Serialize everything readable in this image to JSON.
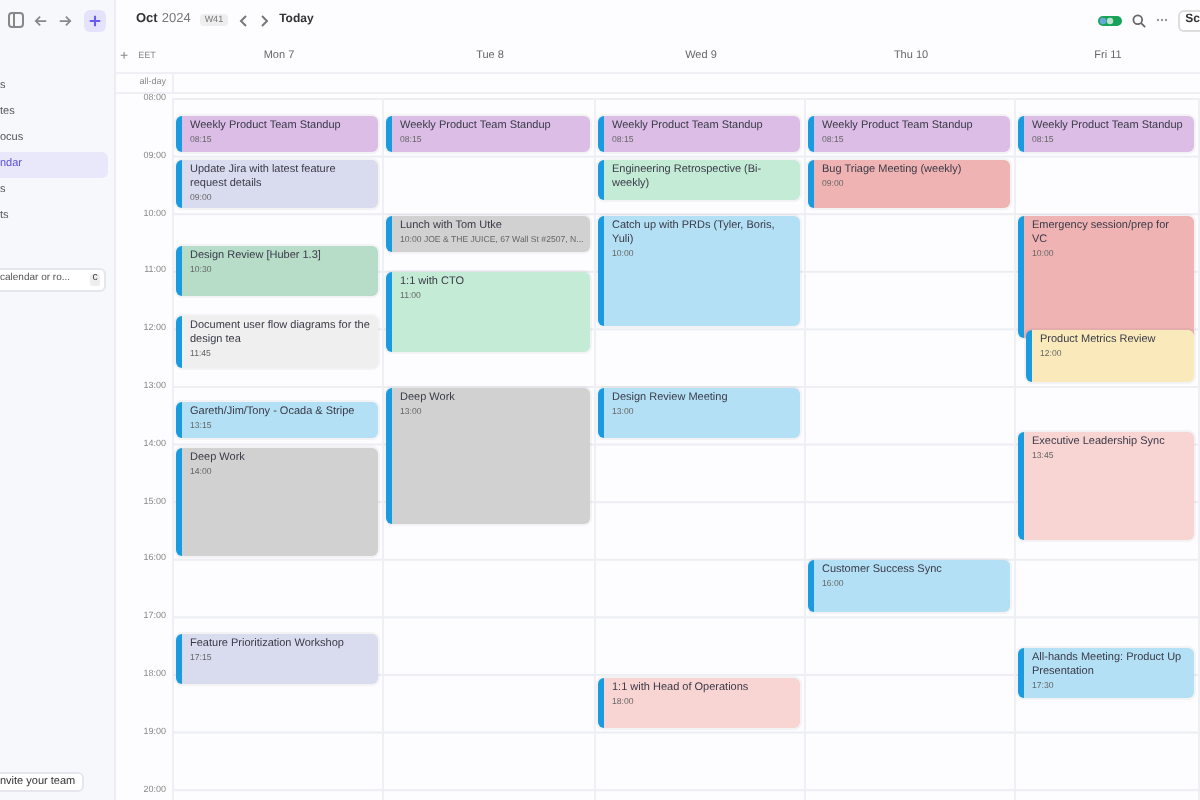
{
  "sidebar": {
    "items": [
      {
        "label": "s",
        "selected": false
      },
      {
        "label": "tes",
        "selected": false
      },
      {
        "label": "ocus",
        "selected": false
      },
      {
        "label": "ndar",
        "selected": true
      },
      {
        "label": "s",
        "selected": false
      },
      {
        "label": "ts",
        "selected": false
      }
    ],
    "search": {
      "placeholder": "calendar or ro...",
      "shortcut": "C"
    },
    "invite": "nvite your team"
  },
  "header": {
    "month": "Oct",
    "year": "2024",
    "week": "W41",
    "today": "Today",
    "view_button": "Sc"
  },
  "grid": {
    "add": "+",
    "timezone": "EET",
    "all_day": "all-day",
    "hours": [
      "08:00",
      "09:00",
      "10:00",
      "11:00",
      "12:00",
      "13:00",
      "14:00",
      "15:00",
      "16:00",
      "17:00",
      "18:00",
      "19:00",
      "20:00"
    ]
  },
  "days": [
    {
      "label": "Mon 7",
      "events": [
        {
          "title": "Weekly Product Team Standup",
          "time": "08:15",
          "color": "#dcbde6"
        },
        {
          "title": "Update Jira with latest feature request details",
          "time": "09:00",
          "color": "#d9dbee"
        },
        {
          "title": "Design Review [Huber 1.3]",
          "time": "10:30",
          "color": "#b7dcc8"
        },
        {
          "title": "Document user flow diagrams for the design tea",
          "time": "11:45",
          "color": "#efefef"
        },
        {
          "title": "Gareth/Jim/Tony - Ocada & Stripe",
          "time": "13:15",
          "color": "#b3e0f5"
        },
        {
          "title": "Deep Work",
          "time": "14:00",
          "color": "#d1d1d1"
        },
        {
          "title": "Feature Prioritization Workshop",
          "time": "17:15",
          "color": "#d9dbee"
        }
      ]
    },
    {
      "label": "Tue 8",
      "events": [
        {
          "title": "Weekly Product Team Standup",
          "time": "08:15",
          "color": "#dcbde6"
        },
        {
          "title": "Lunch with Tom Utke",
          "time": "10:00 JOE & THE JUICE, 67 Wall St #2507, N...",
          "color": "#d1d1d1"
        },
        {
          "title": "1:1 with CTO",
          "time": "11:00",
          "color": "#c3ebd6"
        },
        {
          "title": "Deep Work",
          "time": "13:00",
          "color": "#d1d1d1"
        }
      ]
    },
    {
      "label": "Wed 9",
      "events": [
        {
          "title": "Weekly Product Team Standup",
          "time": "08:15",
          "color": "#dcbde6"
        },
        {
          "title": "Engineering Retrospective (Bi-weekly)",
          "color": "#c3ebd6"
        },
        {
          "title": "Catch up with PRDs (Tyler, Boris, Yuli)",
          "time": "10:00",
          "color": "#b3e0f5"
        },
        {
          "title": "Design Review Meeting",
          "time": "13:00",
          "color": "#b3e0f5"
        },
        {
          "title": "1:1 with Head of Operations",
          "time": "18:00",
          "color": "#f8d4d2"
        }
      ]
    },
    {
      "label": "Thu 10",
      "events": [
        {
          "title": "Weekly Product Team Standup",
          "time": "08:15",
          "color": "#dcbde6"
        },
        {
          "title": "Bug Triage Meeting (weekly)",
          "time": "09:00",
          "color": "#efb3b3"
        },
        {
          "title": "Customer Success Sync",
          "time": "16:00",
          "color": "#b3e0f5"
        }
      ]
    },
    {
      "label": "Fri 11",
      "events": [
        {
          "title": "Weekly Product Team Standup",
          "time": "08:15",
          "color": "#dcbde6"
        },
        {
          "title": "Emergency session/prep for VC",
          "time": "10:00",
          "color": "#efb3b3"
        },
        {
          "title": "Product Metrics Review",
          "time": "12:00",
          "color": "#faeabb"
        },
        {
          "title": "Executive Leadership Sync",
          "time": "13:45",
          "color": "#f8d4d2"
        },
        {
          "title": "All-hands Meeting: Product Up Presentation",
          "time": "17:30",
          "color": "#b3e0f5"
        }
      ]
    }
  ]
}
